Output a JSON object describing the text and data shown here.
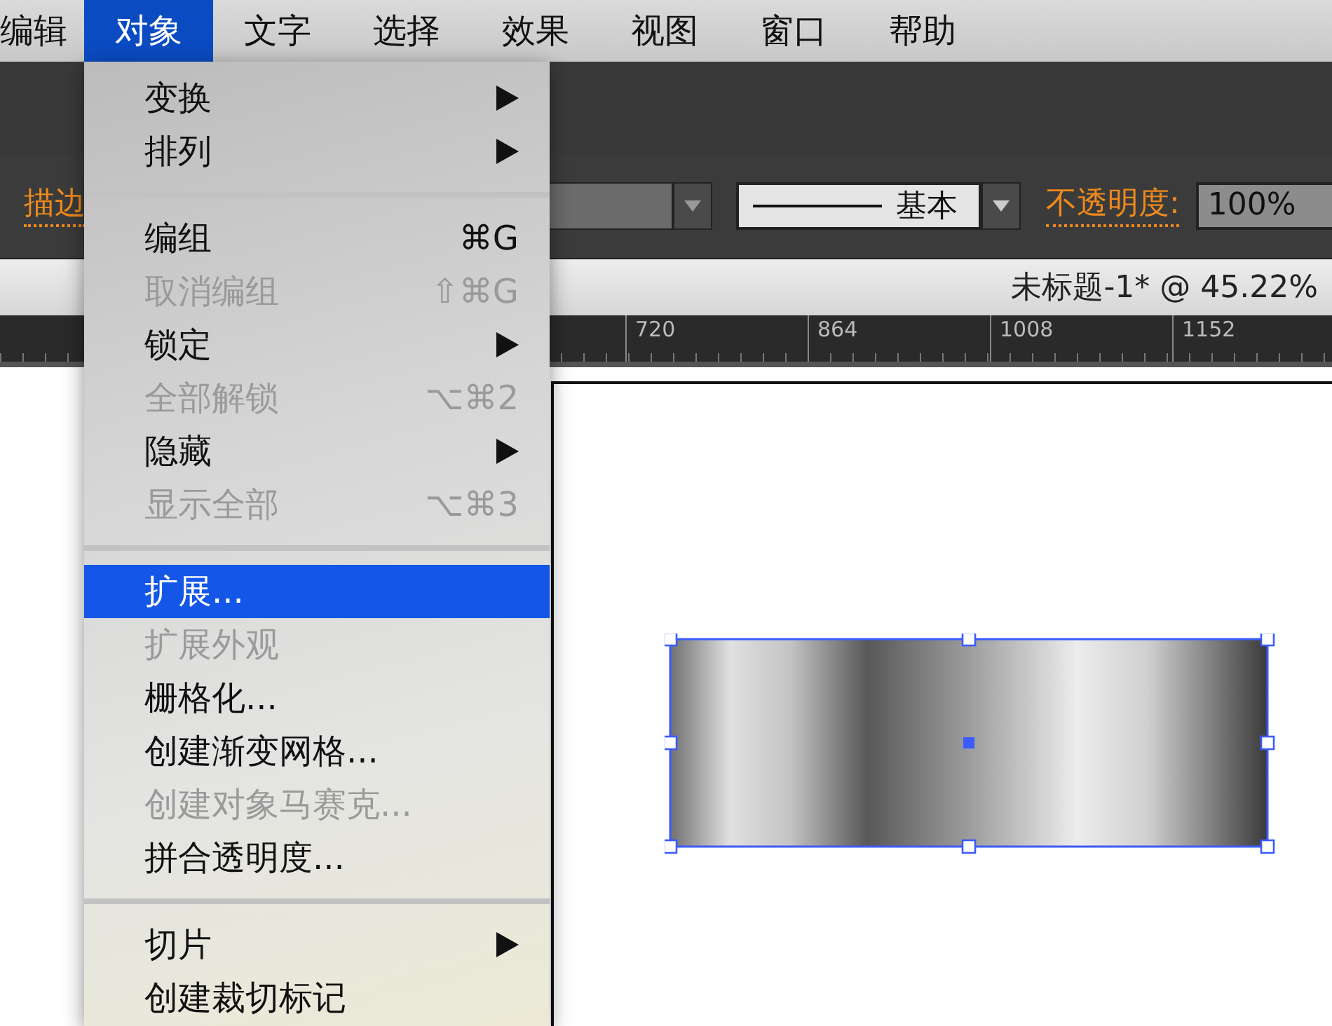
{
  "menubar": [
    {
      "label": "编辑",
      "selected": false
    },
    {
      "label": "对象",
      "selected": true
    },
    {
      "label": "文字",
      "selected": false
    },
    {
      "label": "选择",
      "selected": false
    },
    {
      "label": "效果",
      "selected": false
    },
    {
      "label": "视图",
      "selected": false
    },
    {
      "label": "窗口",
      "selected": false
    },
    {
      "label": "帮助",
      "selected": false
    }
  ],
  "control_bar": {
    "stroke_label": "描边",
    "stroke_style": "基本",
    "opacity_label": "不透明度:",
    "opacity_value": "100%"
  },
  "document_tab": {
    "title": "未标题-1* @ 45.22%"
  },
  "ruler": {
    "labels": [
      "720",
      "864",
      "1008",
      "1152"
    ]
  },
  "menu": {
    "items": [
      {
        "kind": "item",
        "label": "变换",
        "submenu": true,
        "disabled": false,
        "selected": false
      },
      {
        "kind": "item",
        "label": "排列",
        "submenu": true,
        "disabled": false,
        "selected": false
      },
      {
        "kind": "separator"
      },
      {
        "kind": "item",
        "label": "编组",
        "shortcut": "⌘G",
        "submenu": false,
        "disabled": false,
        "selected": false
      },
      {
        "kind": "item",
        "label": "取消编组",
        "shortcut": "⇧⌘G",
        "submenu": false,
        "disabled": true,
        "selected": false
      },
      {
        "kind": "item",
        "label": "锁定",
        "submenu": true,
        "disabled": false,
        "selected": false
      },
      {
        "kind": "item",
        "label": "全部解锁",
        "shortcut": "⌥⌘2",
        "submenu": false,
        "disabled": true,
        "selected": false
      },
      {
        "kind": "item",
        "label": "隐藏",
        "submenu": true,
        "disabled": false,
        "selected": false
      },
      {
        "kind": "item",
        "label": "显示全部",
        "shortcut": "⌥⌘3",
        "submenu": false,
        "disabled": true,
        "selected": false
      },
      {
        "kind": "separator"
      },
      {
        "kind": "item",
        "label": "扩展...",
        "submenu": false,
        "disabled": false,
        "selected": true
      },
      {
        "kind": "item",
        "label": "扩展外观",
        "submenu": false,
        "disabled": true,
        "selected": false
      },
      {
        "kind": "item",
        "label": "栅格化...",
        "submenu": false,
        "disabled": false,
        "selected": false
      },
      {
        "kind": "item",
        "label": "创建渐变网格...",
        "submenu": false,
        "disabled": false,
        "selected": false
      },
      {
        "kind": "item",
        "label": "创建对象马赛克...",
        "submenu": false,
        "disabled": true,
        "selected": false
      },
      {
        "kind": "item",
        "label": "拼合透明度...",
        "submenu": false,
        "disabled": false,
        "selected": false
      },
      {
        "kind": "separator"
      },
      {
        "kind": "item",
        "label": "切片",
        "submenu": true,
        "disabled": false,
        "selected": false
      },
      {
        "kind": "item",
        "label": "创建裁切标记",
        "submenu": false,
        "disabled": false,
        "selected": false
      }
    ]
  }
}
